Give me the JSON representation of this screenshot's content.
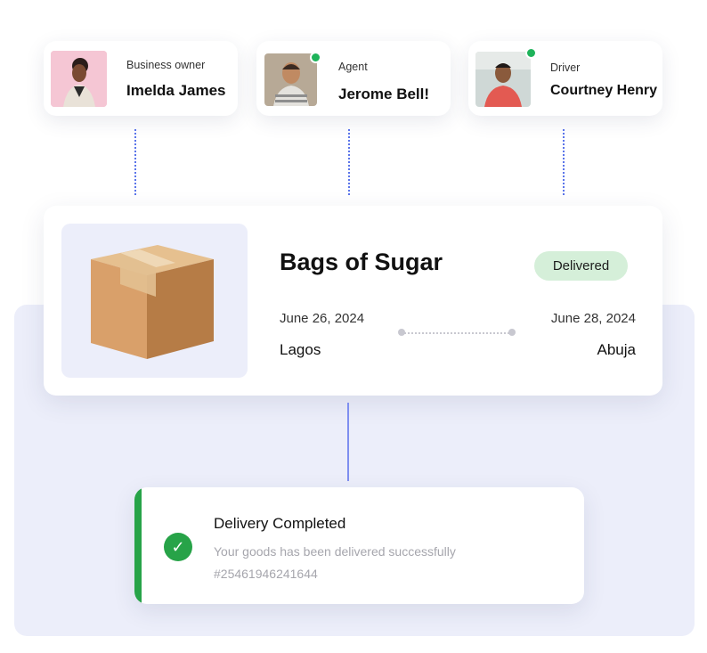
{
  "people": [
    {
      "role": "Business owner",
      "name": "Imelda James",
      "online": false
    },
    {
      "role": "Agent",
      "name": "Jerome Bell!",
      "online": true
    },
    {
      "role": "Driver",
      "name": "Courtney Henry",
      "online": true
    }
  ],
  "shipment": {
    "title": "Bags of Sugar",
    "status": "Delivered",
    "start_date": "June 26, 2024",
    "end_date": "June 28, 2024",
    "origin": "Lagos",
    "destination": "Abuja"
  },
  "delivery": {
    "title": "Delivery Completed",
    "message": "Your goods has been delivered successfully",
    "tracking_id": "#25461946241644"
  },
  "colors": {
    "accent_blue": "#5b75ea",
    "success_green": "#27a348",
    "badge_green": "#d5efd9",
    "panel_lavender": "#eceefa",
    "online_dot": "#1eb35a"
  },
  "icons": {
    "package": "cardboard-box-icon",
    "check": "check-circle-icon"
  }
}
